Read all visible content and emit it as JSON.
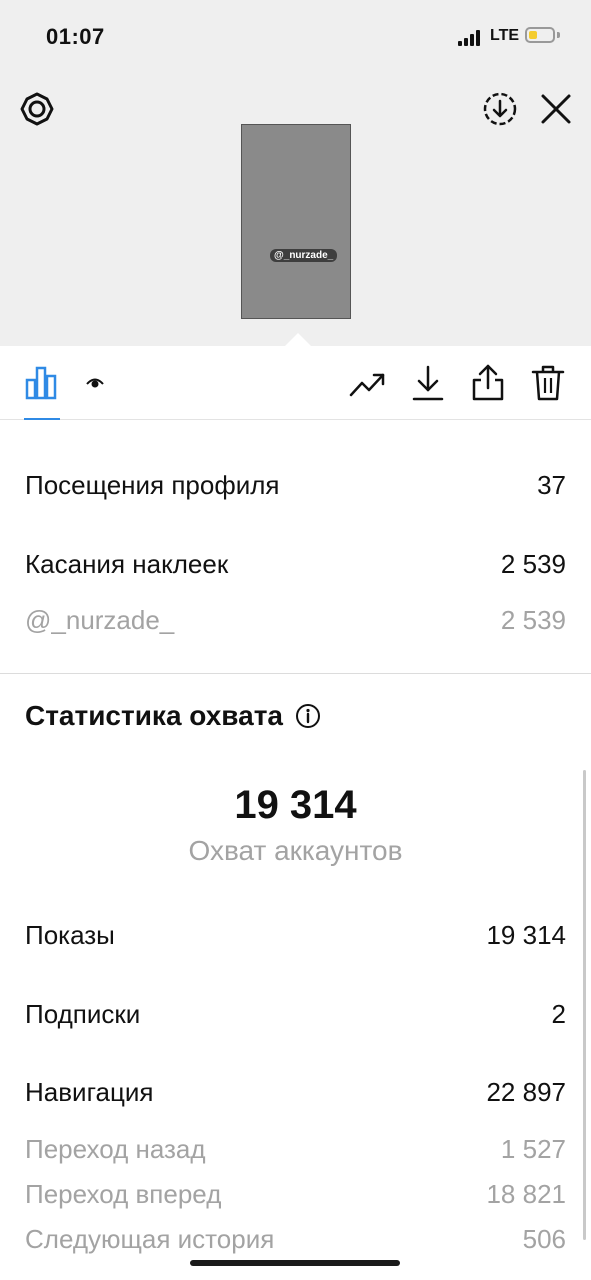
{
  "status_bar": {
    "time": "01:07",
    "network": "LTE",
    "battery_level": 0.35,
    "battery_color": "#f4cc2f"
  },
  "header": {
    "thumbnail_tag": "@_nurzade_"
  },
  "toolbar": {
    "icons": [
      "bar-chart-icon",
      "eye-icon",
      "trend-up-icon",
      "download-icon",
      "share-icon",
      "trash-icon"
    ],
    "active_color": "#2f8ae5"
  },
  "activity": {
    "profile_visits": {
      "label": "Посещения профиля",
      "value": "37"
    },
    "sticker_taps": {
      "label": "Касания наклеек",
      "value": "2 539"
    },
    "sticker_mention": {
      "label": "@_nurzade_",
      "value": "2 539"
    }
  },
  "reach": {
    "title": "Статистика охвата",
    "accounts_reached": "19 314",
    "accounts_reached_label": "Охват аккаунтов",
    "impressions": {
      "label": "Показы",
      "value": "19 314"
    },
    "follows": {
      "label": "Подписки",
      "value": "2"
    },
    "navigation": {
      "label": "Навигация",
      "value": "22 897"
    },
    "back": {
      "label": "Переход назад",
      "value": "1 527"
    },
    "forward": {
      "label": "Переход вперед",
      "value": "18 821"
    },
    "next_story": {
      "label": "Следующая история",
      "value": "506"
    }
  }
}
